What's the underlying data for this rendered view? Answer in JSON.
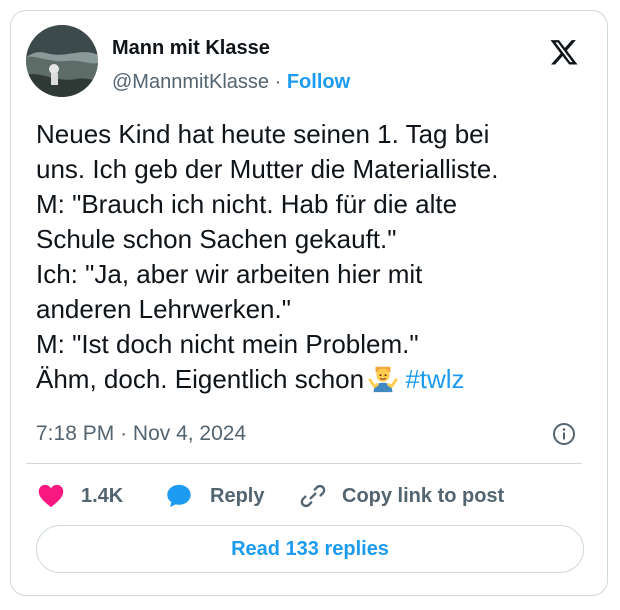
{
  "author": {
    "name": "Mann mit Klasse",
    "handle": "@MannmitKlasse",
    "separator": "·",
    "follow_label": "Follow"
  },
  "tweet": {
    "lines": [
      "Neues Kind hat heute seinen 1. Tag bei",
      "uns. Ich geb der Mutter die Materialliste.",
      "M: \"Brauch ich nicht. Hab für die alte",
      "Schule schon Sachen gekauft.\"",
      "Ich: \"Ja, aber wir arbeiten hier mit",
      "anderen Lehrwerken.\"",
      "M: \"Ist doch nicht mein Problem.\""
    ],
    "last_line": "Ähm, doch. Eigentlich schon",
    "hashtag": "#twlz"
  },
  "meta": {
    "time": "7:18 PM",
    "separator": "·",
    "date": "Nov 4, 2024"
  },
  "actions": {
    "like_count": "1.4K",
    "reply_label": "Reply",
    "copy_label": "Copy link to post"
  },
  "read_replies_label": "Read 133 replies",
  "colors": {
    "accent": "#1d9bf0",
    "like": "#f91880",
    "text": "#0f1419",
    "muted": "#536471",
    "border": "#cfd9de"
  },
  "icons": [
    "avatar-image",
    "x-logo-icon",
    "man-shrugging-emoji",
    "info-icon",
    "heart-icon",
    "reply-bubble-icon",
    "link-icon"
  ]
}
